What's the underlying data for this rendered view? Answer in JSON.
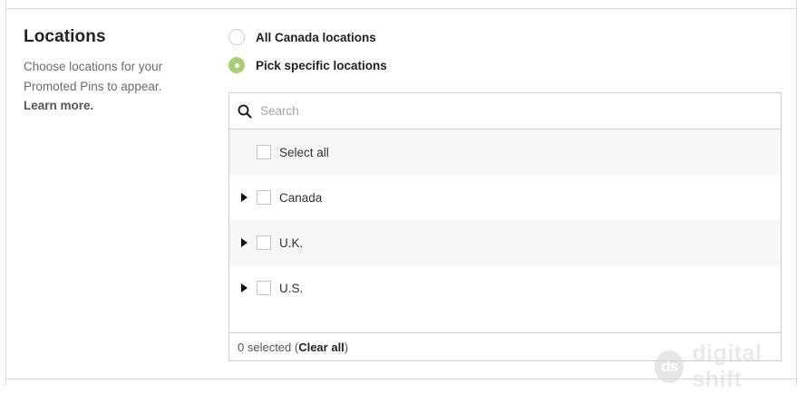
{
  "section": {
    "title": "Locations",
    "description": "Choose locations for your Promoted Pins to appear.",
    "learn_more": "Learn more."
  },
  "radios": [
    {
      "label": "All Canada locations",
      "checked": false
    },
    {
      "label": "Pick specific locations",
      "checked": true
    }
  ],
  "search": {
    "placeholder": "Search",
    "icon": "search-icon"
  },
  "list": {
    "select_all": "Select all",
    "items": [
      {
        "label": "Canada",
        "expandable": true
      },
      {
        "label": "U.K.",
        "expandable": true
      },
      {
        "label": "U.S.",
        "expandable": true
      }
    ]
  },
  "footer": {
    "count_text": "0 selected (",
    "clear_label": "Clear all",
    "close_paren": ")"
  },
  "watermark": {
    "logo": "ds",
    "text": "digital shift"
  },
  "colors": {
    "radio_checked": "#a9cf75",
    "border": "#cfcfcf",
    "row_shade": "#f7f7f7"
  }
}
